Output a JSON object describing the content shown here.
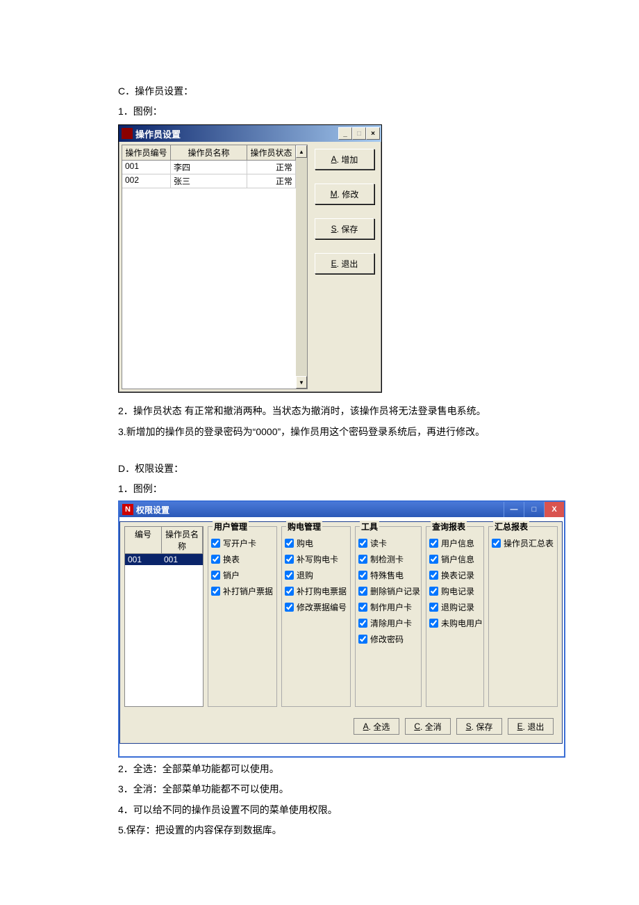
{
  "sectionC": {
    "heading": "C．操作员设置：",
    "line1": "1．图例：",
    "note2": "2．操作员状态 有正常和撤消两种。当状态为撤消时，该操作员将无法登录售电系统。",
    "note3": "3.新增加的操作员的登录密码为“0000”，操作员用这个密码登录系统后，再进行修改。"
  },
  "win1": {
    "title": "操作员设置",
    "columns": {
      "id": "操作员编号",
      "name": "操作员名称",
      "status": "操作员状态"
    },
    "rows": [
      {
        "id": "001",
        "name": "李四",
        "status": "正常"
      },
      {
        "id": "002",
        "name": "张三",
        "status": "正常"
      }
    ],
    "buttons": {
      "add": {
        "key": "A",
        "label": ". 增加"
      },
      "mod": {
        "key": "M",
        "label": ". 修改"
      },
      "save": {
        "key": "S",
        "label": ". 保存"
      },
      "exit": {
        "key": "E",
        "label": ". 退出"
      }
    }
  },
  "sectionD": {
    "heading": "D．权限设置：",
    "line1": "1．图例：",
    "note2": "2．全选：全部菜单功能都可以使用。",
    "note3": "3．全消：全部菜单功能都不可以使用。",
    "note4": "4．可以给不同的操作员设置不同的菜单使用权限。",
    "note5": "5.保存：把设置的内容保存到数据库。"
  },
  "win2": {
    "title": "权限设置",
    "appIcon": "N",
    "operatorList": {
      "headers": {
        "id": "编号",
        "name": "操作员名称"
      },
      "rows": [
        {
          "id": "001",
          "name": "001"
        }
      ]
    },
    "groups": {
      "user": {
        "legend": "用户管理",
        "items": [
          "写开户卡",
          "换表",
          "销户",
          "补打销户票据"
        ]
      },
      "power": {
        "legend": "购电管理",
        "items": [
          "购电",
          "补写购电卡",
          "退购",
          "补打购电票据",
          "修改票据编号"
        ]
      },
      "tools": {
        "legend": "工具",
        "items": [
          "读卡",
          "制检测卡",
          "特殊售电",
          "删除销户记录",
          "制作用户卡",
          "清除用户卡",
          "修改密码"
        ]
      },
      "query": {
        "legend": "查询报表",
        "items": [
          "用户信息",
          "销户信息",
          "换表记录",
          "购电记录",
          "退购记录",
          "未购电用户"
        ]
      },
      "summary": {
        "legend": "汇总报表",
        "items": [
          "操作员汇总表"
        ]
      }
    },
    "footer": {
      "all": {
        "key": "A",
        "label": ". 全选"
      },
      "none": {
        "key": "C",
        "label": ". 全消"
      },
      "save": {
        "key": "S",
        "label": ". 保存"
      },
      "exit": {
        "key": "E",
        "label": ". 退出"
      }
    }
  }
}
